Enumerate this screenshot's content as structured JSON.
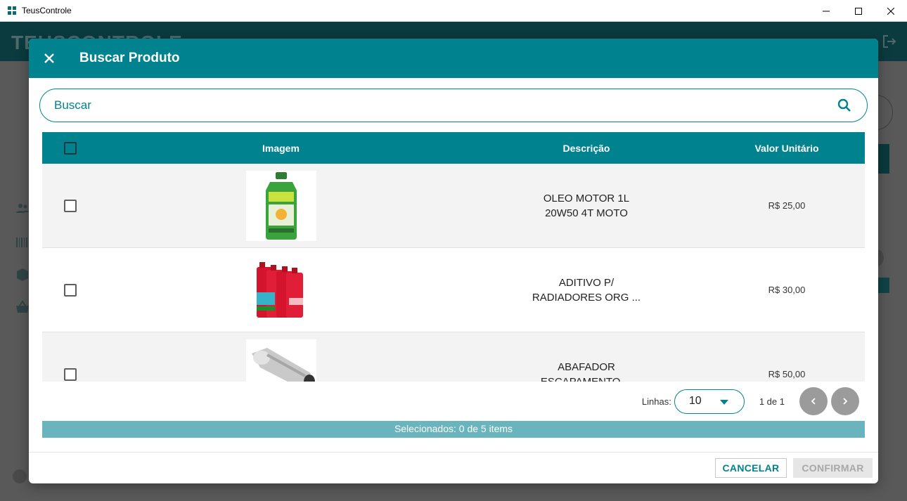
{
  "window": {
    "title": "TeusControle"
  },
  "background": {
    "logo": "TEUSCONTROLE"
  },
  "modal": {
    "title": "Buscar Produto",
    "search_placeholder": "Buscar",
    "columns": {
      "image": "Imagem",
      "description": "Descrição",
      "unit_value": "Valor Unitário"
    },
    "rows": [
      {
        "description_line1": "OLEO MOTOR 1L",
        "description_line2": "20W50 4T MOTO",
        "value": "R$ 25,00",
        "image": "motor-oil-bottle-image"
      },
      {
        "description_line1": "ADITIVO P/",
        "description_line2": "RADIADORES ORG ...",
        "value": "R$ 30,00",
        "image": "radiator-additive-bottles-image"
      },
      {
        "description_line1": "ABAFADOR",
        "description_line2": "ESCAPAMENTO ...",
        "value": "R$ 50,00",
        "image": "muffler-image"
      }
    ],
    "pagination": {
      "lines_label": "Linhas:",
      "lines_value": "10",
      "page_info": "1 de 1"
    },
    "selected_text": "Selecionados: 0 de 5 items",
    "buttons": {
      "cancel": "CANCELAR",
      "confirm": "CONFIRMAR"
    }
  },
  "colors": {
    "primary": "#00838f",
    "selected_bar": "#6ab4bd",
    "pager_button": "#9b9b9b"
  }
}
